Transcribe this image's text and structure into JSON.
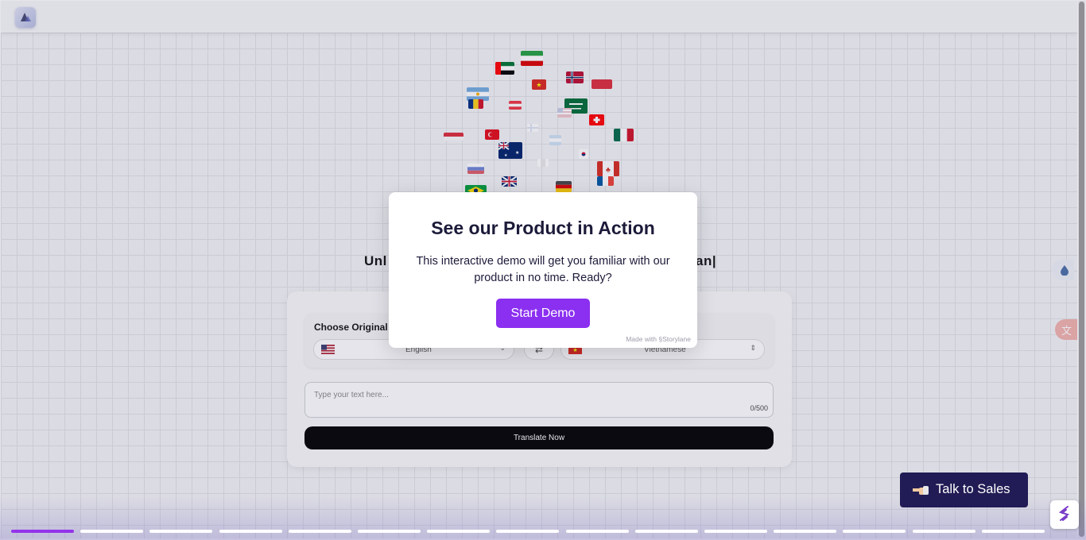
{
  "app": {
    "hero_heading_left": "Unl",
    "hero_heading_right": "an|",
    "lang_panel_title": "Choose Original",
    "source_language": "English",
    "target_language": "Vietnamese",
    "swap_symbol": "⇄",
    "text_placeholder": "Type your text here...",
    "char_counter": "0/500",
    "translate_label": "Translate Now"
  },
  "modal": {
    "title": "See our Product in Action",
    "description": "This interactive demo will get you familiar with our product in no time. Ready?",
    "start_label": "Start Demo",
    "made_with_prefix": "Made with",
    "made_with_brand": "Storylane"
  },
  "sales": {
    "label": "Talk to Sales",
    "icon": "pointing-hand-icon"
  },
  "progress": {
    "total_steps": 15,
    "current_step": 1
  },
  "colors": {
    "accent": "#8b2ff0",
    "sales_bg": "#211c55",
    "modal_text": "#1c1b3a",
    "step_active": "#9333ea"
  }
}
